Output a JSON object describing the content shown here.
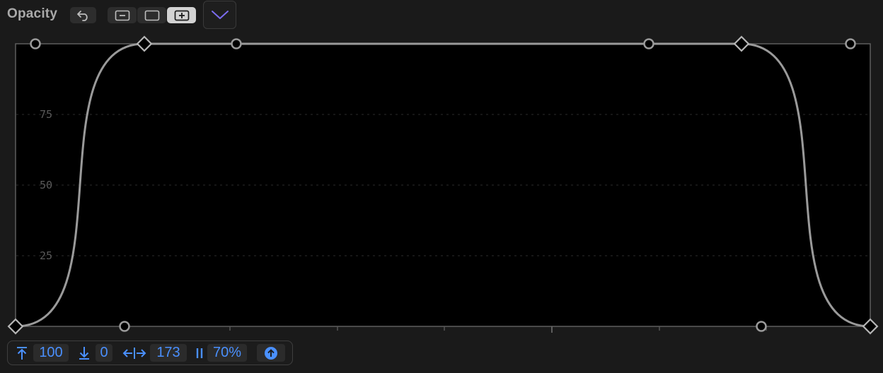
{
  "toolbar": {
    "title": "Opacity",
    "buttons": [
      {
        "name": "undo-button",
        "icon": "undo-icon",
        "active": false
      },
      {
        "name": "zoom-out-button",
        "icon": "minus-square-icon",
        "active": false
      },
      {
        "name": "fit-button",
        "icon": "square-icon",
        "active": false
      },
      {
        "name": "zoom-in-button",
        "icon": "plus-square-icon",
        "active": true
      },
      {
        "name": "collapse-button",
        "icon": "chevron-down-icon",
        "accent": "#7b6cf0"
      }
    ]
  },
  "graph": {
    "y_axis_labels": [
      "75",
      "50",
      "25"
    ],
    "ylim": [
      0,
      100
    ],
    "curve_color": "#9a9a9a",
    "background": "#000000",
    "grid": "dotted"
  },
  "bottom_bar": {
    "max_value": "100",
    "min_value": "0",
    "width_value": "173",
    "smoothness_value": "70%",
    "accent_color": "#4a90ff",
    "icons": [
      "arrow-up-to-top-icon",
      "arrow-down-to-bottom-icon",
      "horizontal-spread-icon",
      "pause-bars-icon",
      "upload-circle-icon"
    ]
  }
}
